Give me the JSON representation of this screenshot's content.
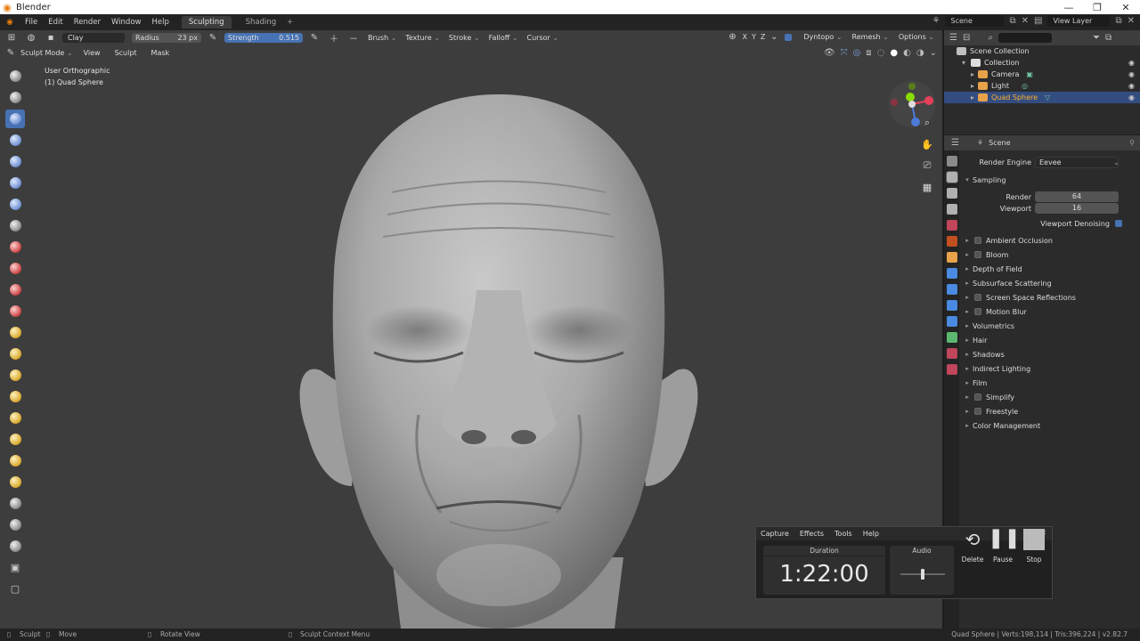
{
  "window": {
    "title": "Blender",
    "controls": [
      "—",
      "❐",
      "✕"
    ]
  },
  "menubar": {
    "items": [
      "File",
      "Edit",
      "Render",
      "Window",
      "Help"
    ],
    "workspaces": [
      "Sculpting",
      "Shading"
    ],
    "active_workspace": "Sculpting",
    "scene": "Scene",
    "view_layer": "View Layer"
  },
  "tool_header": {
    "brush_name": "Clay",
    "radius_label": "Radius",
    "radius_value": "23 px",
    "strength_label": "Strength",
    "strength_value": "0.515",
    "menus": [
      "Brush",
      "Texture",
      "Stroke",
      "Falloff",
      "Cursor"
    ],
    "axes": [
      "X",
      "Y",
      "Z"
    ],
    "right_menus": [
      "Dyntopo",
      "Remesh",
      "Options"
    ]
  },
  "viewport": {
    "mode": "Sculpt Mode",
    "menus": [
      "View",
      "Sculpt",
      "Mask"
    ],
    "view_name": "User Orthographic",
    "object_label": "(1) Quad Sphere"
  },
  "outliner": {
    "root": "Scene Collection",
    "collection": "Collection",
    "objects": [
      "Camera",
      "Light",
      "Quad Sphere"
    ],
    "selected": "Quad Sphere"
  },
  "properties": {
    "context": "Scene",
    "render_engine_label": "Render Engine",
    "render_engine": "Eevee",
    "sampling_label": "Sampling",
    "render_label": "Render",
    "render_samples": "64",
    "viewport_label": "Viewport",
    "viewport_samples": "16",
    "viewport_denoising": "Viewport Denoising",
    "panels": [
      {
        "label": "Ambient Occlusion",
        "checkbox": true
      },
      {
        "label": "Bloom",
        "checkbox": true
      },
      {
        "label": "Depth of Field",
        "checkbox": false
      },
      {
        "label": "Subsurface Scattering",
        "checkbox": false
      },
      {
        "label": "Screen Space Reflections",
        "checkbox": true
      },
      {
        "label": "Motion Blur",
        "checkbox": true
      },
      {
        "label": "Volumetrics",
        "checkbox": false
      },
      {
        "label": "Hair",
        "checkbox": false
      },
      {
        "label": "Shadows",
        "checkbox": false
      },
      {
        "label": "Indirect Lighting",
        "checkbox": false
      },
      {
        "label": "Film",
        "checkbox": false
      },
      {
        "label": "Simplify",
        "checkbox": true
      },
      {
        "label": "Freestyle",
        "checkbox": true
      },
      {
        "label": "Color Management",
        "checkbox": false
      }
    ]
  },
  "statusbar": {
    "left_action": "Sculpt",
    "move": "Move",
    "rotate": "Rotate View",
    "context_menu": "Sculpt Context Menu",
    "stats": "Quad Sphere | Verts:198,114 | Tris:396,224 | v2.82.7"
  },
  "capture": {
    "menus": [
      "Capture",
      "Effects",
      "Tools",
      "Help"
    ],
    "duration_label": "Duration",
    "duration": "1:22:00",
    "audio_label": "Audio",
    "audio_level": 0.5,
    "delete_label": "Delete",
    "pause_label": "Pause",
    "stop_label": "Stop"
  },
  "colors": {
    "accent_blue": "#4772b3",
    "blender_orange": "#e87d0d",
    "viewport_bg": "#3d3d3d",
    "selected_row": "#334d80"
  }
}
